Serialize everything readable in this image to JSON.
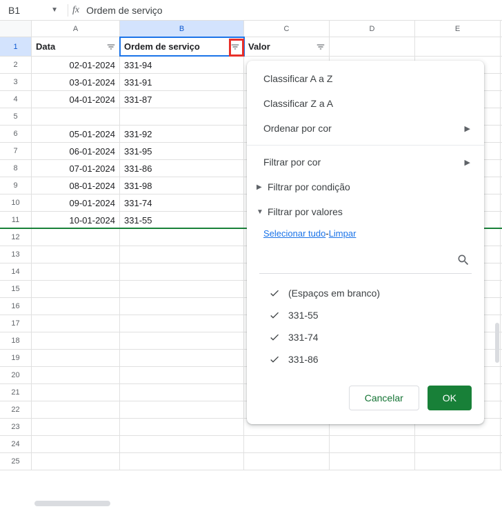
{
  "formula_bar": {
    "cell_ref": "B1",
    "fx": "fx",
    "value": "Ordem de serviço"
  },
  "columns": {
    "A": "A",
    "B": "B",
    "C": "C",
    "D": "D",
    "E": "E"
  },
  "headers": {
    "A": "Data",
    "B": "Ordem de serviço",
    "C": "Valor"
  },
  "rows": [
    {
      "n": "1"
    },
    {
      "n": "2",
      "A": "02-01-2024",
      "B": "331-94"
    },
    {
      "n": "3",
      "A": "03-01-2024",
      "B": "331-91"
    },
    {
      "n": "4",
      "A": "04-01-2024",
      "B": "331-87"
    },
    {
      "n": "5",
      "A": "",
      "B": ""
    },
    {
      "n": "6",
      "A": "05-01-2024",
      "B": "331-92"
    },
    {
      "n": "7",
      "A": "06-01-2024",
      "B": "331-95"
    },
    {
      "n": "8",
      "A": "07-01-2024",
      "B": "331-86"
    },
    {
      "n": "9",
      "A": "08-01-2024",
      "B": "331-98"
    },
    {
      "n": "10",
      "A": "09-01-2024",
      "B": "331-74"
    },
    {
      "n": "11",
      "A": "10-01-2024",
      "B": "331-55"
    },
    {
      "n": "12"
    },
    {
      "n": "13"
    },
    {
      "n": "14"
    },
    {
      "n": "15"
    },
    {
      "n": "16"
    },
    {
      "n": "17"
    },
    {
      "n": "18"
    },
    {
      "n": "19"
    },
    {
      "n": "20"
    },
    {
      "n": "21"
    },
    {
      "n": "22"
    },
    {
      "n": "23"
    },
    {
      "n": "24"
    },
    {
      "n": "25"
    }
  ],
  "menu": {
    "sort_az": "Classificar A a Z",
    "sort_za": "Classificar Z a A",
    "sort_color": "Ordenar por cor",
    "filter_color": "Filtrar por cor",
    "filter_cond": "Filtrar por condição",
    "filter_values": "Filtrar por valores",
    "select_all": "Selecionar tudo",
    "sep": "-",
    "clear": "Limpar",
    "search_placeholder": "",
    "values": [
      {
        "label": "(Espaços em branco)"
      },
      {
        "label": "331-55"
      },
      {
        "label": "331-74"
      },
      {
        "label": "331-86"
      }
    ],
    "cancel": "Cancelar",
    "ok": "OK"
  }
}
